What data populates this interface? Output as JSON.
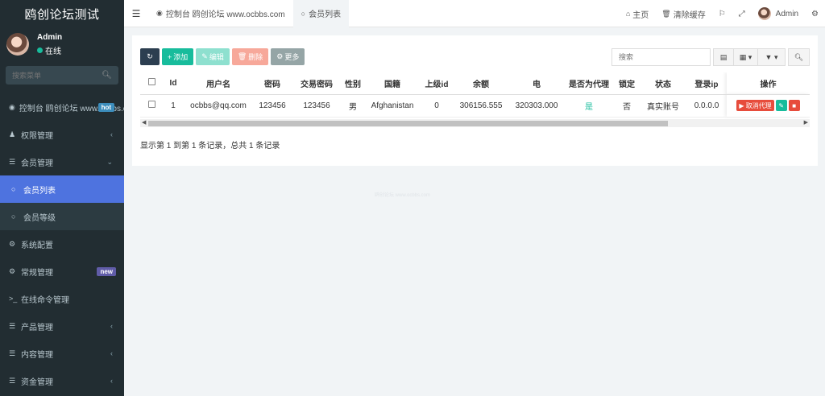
{
  "brand": "鸥创论坛测试",
  "user": {
    "name": "Admin",
    "status": "在线"
  },
  "sidebar_search": {
    "placeholder": "搜索菜单"
  },
  "menu": {
    "dashboard": "控制台 鸥创论坛 www.ocbbs.com",
    "dashboard_badge": "hot",
    "auth": "权限管理",
    "member": "会员管理",
    "member_list": "会员列表",
    "member_level": "会员等级",
    "system": "系统配置",
    "general": "常规管理",
    "general_badge": "new",
    "command": "在线命令管理",
    "product": "产品管理",
    "content": "内容管理",
    "finance": "资金管理"
  },
  "topbar": {
    "tabs": [
      "控制台 鸥创论坛 www.ocbbs.com",
      "会员列表"
    ],
    "home": "主页",
    "clear_cache": "清除缓存",
    "admin": "Admin"
  },
  "toolbar": {
    "add": "添加",
    "edit": "编辑",
    "delete": "删除",
    "more": "更多",
    "search_placeholder": "搜索"
  },
  "table": {
    "headers": [
      "Id",
      "用户名",
      "密码",
      "交易密码",
      "性别",
      "国籍",
      "上级id",
      "余额",
      "电",
      "是否为代理",
      "锁定",
      "状态",
      "登录ip",
      "操作"
    ],
    "rows": [
      [
        "1",
        "ocbbs@qq.com",
        "123456",
        "123456",
        "男",
        "Afghanistan",
        "0",
        "306156.555",
        "320303.000",
        "是",
        "否",
        "真实账号",
        "0.0.0.0"
      ]
    ],
    "op_cancel_agent": "取消代理"
  },
  "footer": "显示第 1 到第 1 条记录，总共 1 条记录",
  "watermark": "鸥创论坛 www.ocbbs.com",
  "colors": {
    "sidebar": "#222d32",
    "active": "#4e73df",
    "success": "#18bc9c",
    "danger": "#e74c3c"
  }
}
